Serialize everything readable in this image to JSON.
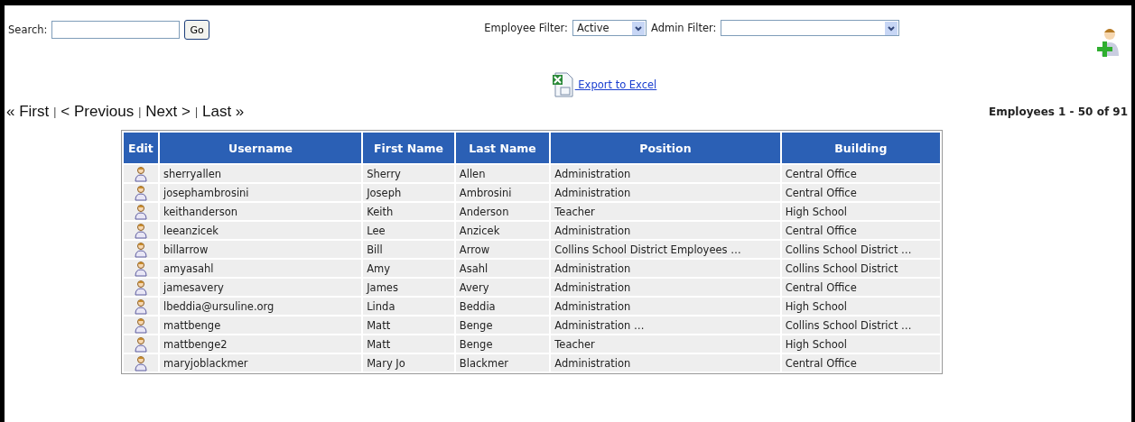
{
  "search": {
    "label": "Search:",
    "button": "Go"
  },
  "employee_filter": {
    "label": "Employee Filter:",
    "value": "Active"
  },
  "admin_filter": {
    "label": "Admin Filter:"
  },
  "export": {
    "label": " Export to Excel"
  },
  "pagination": {
    "links": [
      "« First",
      "< Previous",
      "Next >",
      "Last »"
    ],
    "separator": "|",
    "summary": "Employees 1 - 50 of 91"
  },
  "table": {
    "columns": [
      "Edit",
      "Username",
      "First Name",
      "Last Name",
      "Position",
      "Building"
    ],
    "rows": [
      {
        "username": "sherryallen",
        "first_name": "Sherry",
        "last_name": "Allen",
        "position": "Administration",
        "building": "Central Office"
      },
      {
        "username": "josephambrosini",
        "first_name": "Joseph",
        "last_name": "Ambrosini",
        "position": "Administration",
        "building": "Central Office"
      },
      {
        "username": "keithanderson",
        "first_name": "Keith",
        "last_name": "Anderson",
        "position": "Teacher",
        "building": "High School"
      },
      {
        "username": "leeanzicek",
        "first_name": "Lee",
        "last_name": "Anzicek",
        "position": "Administration",
        "building": "Central Office"
      },
      {
        "username": "billarrow",
        "first_name": "Bill",
        "last_name": "Arrow",
        "position": "Collins School District Employees …",
        "building": "Collins School District …"
      },
      {
        "username": "amyasahl",
        "first_name": "Amy",
        "last_name": "Asahl",
        "position": "Administration",
        "building": "Collins School District"
      },
      {
        "username": "jamesavery",
        "first_name": "James",
        "last_name": "Avery",
        "position": "Administration",
        "building": "Central Office"
      },
      {
        "username": "lbeddia@ursuline.org",
        "first_name": "Linda",
        "last_name": "Beddia",
        "position": "Administration",
        "building": "High School"
      },
      {
        "username": "mattbenge",
        "first_name": "Matt",
        "last_name": "Benge",
        "position": "Administration …",
        "building": "Collins School District …"
      },
      {
        "username": "mattbenge2",
        "first_name": "Matt",
        "last_name": "Benge",
        "position": "Teacher",
        "building": "High School"
      },
      {
        "username": "maryjoblackmer",
        "first_name": "Mary Jo",
        "last_name": "Blackmer",
        "position": "Administration",
        "building": "Central Office"
      }
    ]
  }
}
